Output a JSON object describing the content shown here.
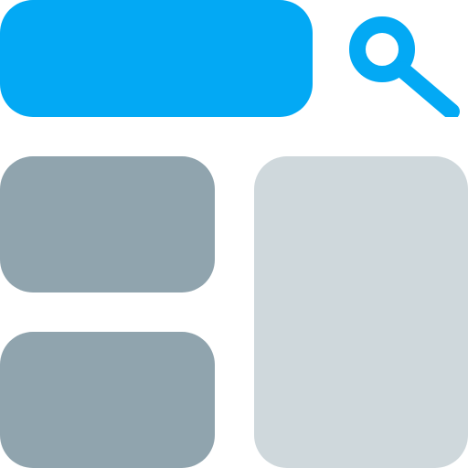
{
  "colors": {
    "accent": "#03a9f4",
    "card_dark": "#90a4ae",
    "panel_light": "#cfd8dc"
  },
  "icons": {
    "search": "search-icon"
  }
}
